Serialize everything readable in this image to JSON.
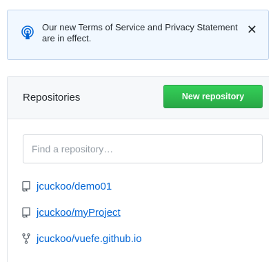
{
  "notice": {
    "icon": "broadcast-icon",
    "message": "Our new Terms of Service and Privacy Statement are in effect.",
    "close_glyph": "✕"
  },
  "repositories": {
    "title": "Repositories",
    "new_button_label": "New repository",
    "search_placeholder": "Find a repository…",
    "items": [
      {
        "name": "jcuckoo/demo01",
        "icon": "repo-icon",
        "hovered": false
      },
      {
        "name": "jcuckoo/myProject",
        "icon": "repo-icon",
        "hovered": true
      },
      {
        "name": "jcuckoo/vuefe.github.io",
        "icon": "fork-icon",
        "hovered": false
      }
    ]
  },
  "colors": {
    "link": "#0366d6",
    "button": "#28a745",
    "notice_bg": "#f1f8ff"
  }
}
